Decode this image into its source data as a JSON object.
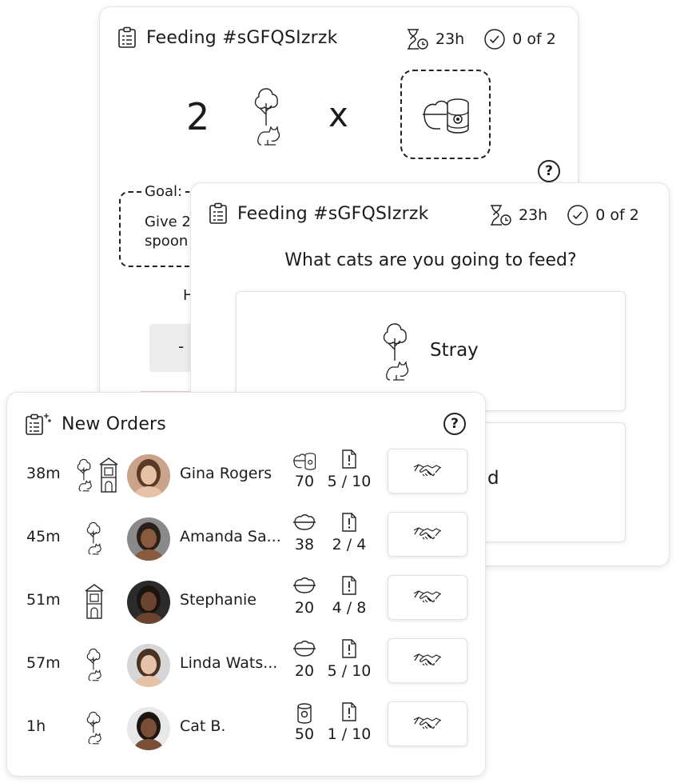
{
  "back_card": {
    "title": "Feeding #sGFQSIzrzk",
    "time_left": "23h",
    "progress": "0 of 2",
    "quantity": "2",
    "multiplier": "x",
    "goal_label": "Goal: ",
    "goal_text_line1": "Give 2",
    "goal_text_line2": "spoon",
    "partial_label": "H",
    "minus_button": "-"
  },
  "front_card": {
    "title": "Feeding #sGFQSIzrzk",
    "time_left": "23h",
    "progress": "0 of 2",
    "question": "What cats are you going to feed?",
    "options": [
      {
        "label": "Stray",
        "icon": "tree-cat-icon"
      },
      {
        "label": "d",
        "icon": ""
      }
    ]
  },
  "orders": {
    "title": "New Orders",
    "help": "?",
    "rows": [
      {
        "time": "38m",
        "type_icons": [
          "tree-cat-icon",
          "shelter-icon"
        ],
        "name": "Gina Rogers",
        "food_icon": "bowl-can-icon",
        "quantity": "70",
        "tasks": "5 / 10",
        "avatar_bg": "#c9a38a",
        "avatar_hair": "#5a3a26",
        "avatar_skin": "#e8c2a6"
      },
      {
        "time": "45m",
        "type_icons": [
          "tree-cat-icon"
        ],
        "name": "Amanda Sa...",
        "food_icon": "bowl-icon",
        "quantity": "38",
        "tasks": "2 / 4",
        "avatar_bg": "#8a8a8a",
        "avatar_hair": "#2a1f1a",
        "avatar_skin": "#8a5a3e"
      },
      {
        "time": "51m",
        "type_icons": [
          "shelter-icon"
        ],
        "name": "Stephanie",
        "food_icon": "bowl-icon",
        "quantity": "20",
        "tasks": "4 / 8",
        "avatar_bg": "#2b2b2b",
        "avatar_hair": "#1a1411",
        "avatar_skin": "#6b4430"
      },
      {
        "time": "57m",
        "type_icons": [
          "tree-cat-icon"
        ],
        "name": "Linda Wats...",
        "food_icon": "bowl-icon",
        "quantity": "20",
        "tasks": "5 / 10",
        "avatar_bg": "#d6d6d6",
        "avatar_hair": "#4a3222",
        "avatar_skin": "#e6c3a8"
      },
      {
        "time": "1h",
        "type_icons": [
          "tree-cat-icon"
        ],
        "name": "Cat B.",
        "food_icon": "can-icon",
        "quantity": "50",
        "tasks": "1 / 10",
        "avatar_bg": "#e8e8e8",
        "avatar_hair": "#1c1512",
        "avatar_skin": "#7a4e36"
      }
    ]
  }
}
